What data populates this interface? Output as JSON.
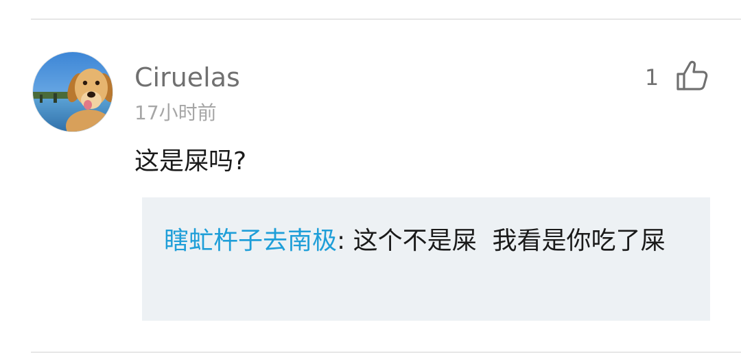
{
  "comment": {
    "username": "Ciruelas",
    "timestamp": "17小时前",
    "like_count": "1",
    "body": "这是屎吗?",
    "avatar_icon": "golden-retriever-puppy-avatar",
    "like_icon": "thumbs-up-icon"
  },
  "reply": {
    "author": "瞎虻杵子去南极",
    "separator": ": ",
    "text": "这个不是屎  我看是你吃了屎"
  },
  "colors": {
    "reply_author": "#1e9ed8",
    "reply_background": "#edf1f4",
    "username": "#707070",
    "timestamp": "#a6a6a6",
    "body_text": "#1a1a1a"
  }
}
